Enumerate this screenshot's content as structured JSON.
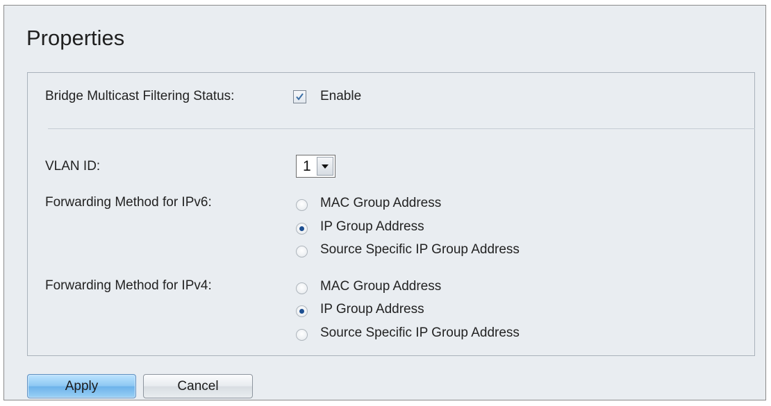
{
  "page": {
    "title": "Properties"
  },
  "filtering": {
    "label": "Bridge Multicast Filtering Status:",
    "checkbox_label": "Enable",
    "enabled": true
  },
  "vlan": {
    "label": "VLAN ID:",
    "selected": "1"
  },
  "ipv6": {
    "label": "Forwarding Method for IPv6:",
    "options": [
      {
        "label": "MAC Group Address",
        "selected": false
      },
      {
        "label": "IP Group Address",
        "selected": true
      },
      {
        "label": "Source Specific IP Group Address",
        "selected": false
      }
    ]
  },
  "ipv4": {
    "label": "Forwarding Method for IPv4:",
    "options": [
      {
        "label": "MAC Group Address",
        "selected": false
      },
      {
        "label": "IP Group Address",
        "selected": true
      },
      {
        "label": "Source Specific IP Group Address",
        "selected": false
      }
    ]
  },
  "actions": {
    "apply_label": "Apply",
    "cancel_label": "Cancel"
  },
  "icons": {
    "checkbox": "checkmark-icon",
    "dropdown": "chevron-down-icon"
  },
  "colors": {
    "background": "#e9edf1",
    "radio_dot": "#1d4f91",
    "apply_button": "#8cc7f2"
  }
}
